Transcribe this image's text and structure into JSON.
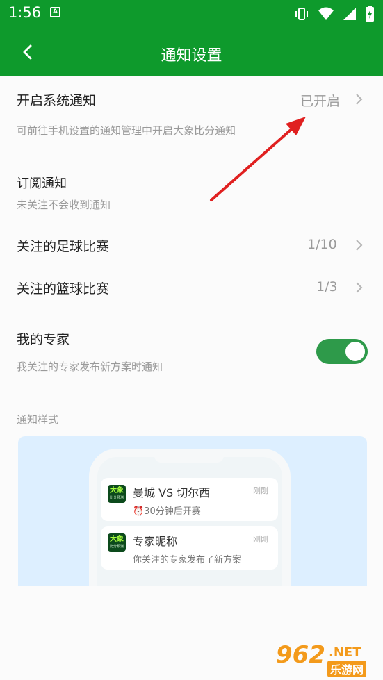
{
  "status_bar": {
    "time": "1:56",
    "notification_icon_text": "A",
    "icons": [
      "vibrate-icon",
      "wifi-icon",
      "signal-icon",
      "battery-icon"
    ]
  },
  "app_bar": {
    "title": "通知设置",
    "back_icon": "chevron-left-icon"
  },
  "system_notification": {
    "title": "开启系统通知",
    "value": "已开启",
    "description": "可前往手机设置的通知管理中开启大象比分通知"
  },
  "subscription": {
    "title": "订阅通知",
    "description": "未关注不会收到通知"
  },
  "football": {
    "title": "关注的足球比赛",
    "value": "1/10"
  },
  "basketball": {
    "title": "关注的篮球比赛",
    "value": "1/3"
  },
  "my_experts": {
    "title": "我的专家",
    "description": "我关注的专家发布新方案时通知",
    "enabled": true
  },
  "style_section": {
    "label": "通知样式",
    "cards": [
      {
        "app_logo_text": "大象",
        "app_logo_sub": "比分预测",
        "title": "曼城 VS 切尔西",
        "time": "刚刚",
        "body": "⏰30分钟后开赛"
      },
      {
        "app_logo_text": "大象",
        "app_logo_sub": "比分预测",
        "title": "专家昵称",
        "time": "刚刚",
        "body": "你关注的专家发布了新方案"
      }
    ]
  },
  "watermark": {
    "logo": "962",
    "suffix": ".NET",
    "sub": "乐游网"
  },
  "colors": {
    "brand_green": "#0e9a2c",
    "toggle_green": "#2e9a4a",
    "annotation_arrow": "#e02020"
  }
}
